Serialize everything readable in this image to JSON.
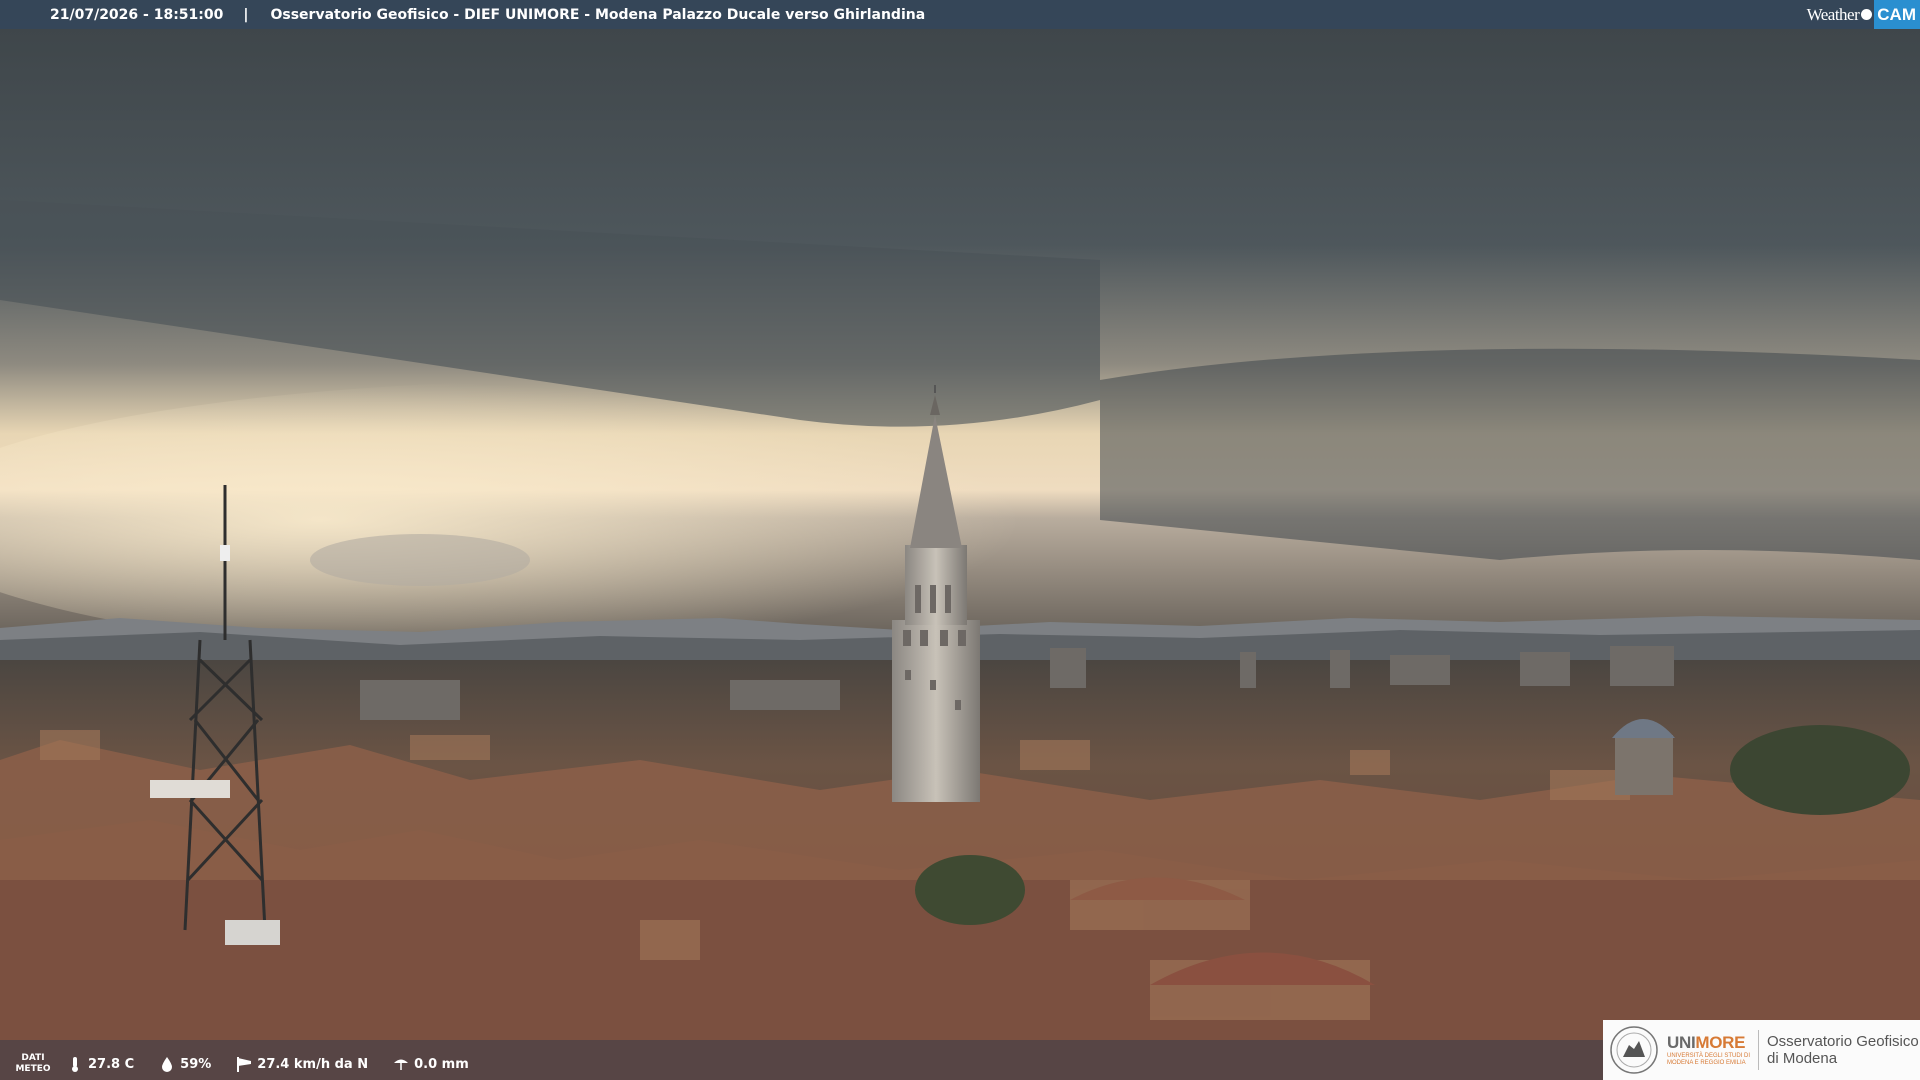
{
  "header": {
    "timestamp": "21/07/2026 - 18:51:00",
    "separator": "|",
    "title": "Osservatorio Geofisico - DIEF UNIMORE - Modena Palazzo Ducale verso Ghirlandina"
  },
  "brand": {
    "part1": "Weather",
    "part2": "CAM"
  },
  "weather_bar": {
    "label_line1": "DATI",
    "label_line2": "METEO",
    "temperature": "27.8 C",
    "humidity": "59%",
    "wind": "27.4 km/h da N",
    "rain": "0.0 mm",
    "icons": [
      "thermometer-icon",
      "humidity-drop-icon",
      "wind-sock-icon",
      "rain-gauge-icon"
    ]
  },
  "logo_box": {
    "uni_part1": "UNI",
    "uni_part2": "MORE",
    "uni_sub1": "UNIVERSITÀ DEGLI STUDI DI",
    "uni_sub2": "MODENA E REGGIO EMILIA",
    "obs_line1": "Osservatorio Geofisico",
    "obs_line2": "di Modena"
  },
  "colors": {
    "sky_dark": "#4a5257",
    "sky_glow": "#f3e2bd",
    "roofs": "#7a5442",
    "bar_bg": "#34465a",
    "brand_blue": "#2a8fd0",
    "unimore_orange": "#d77a35"
  }
}
